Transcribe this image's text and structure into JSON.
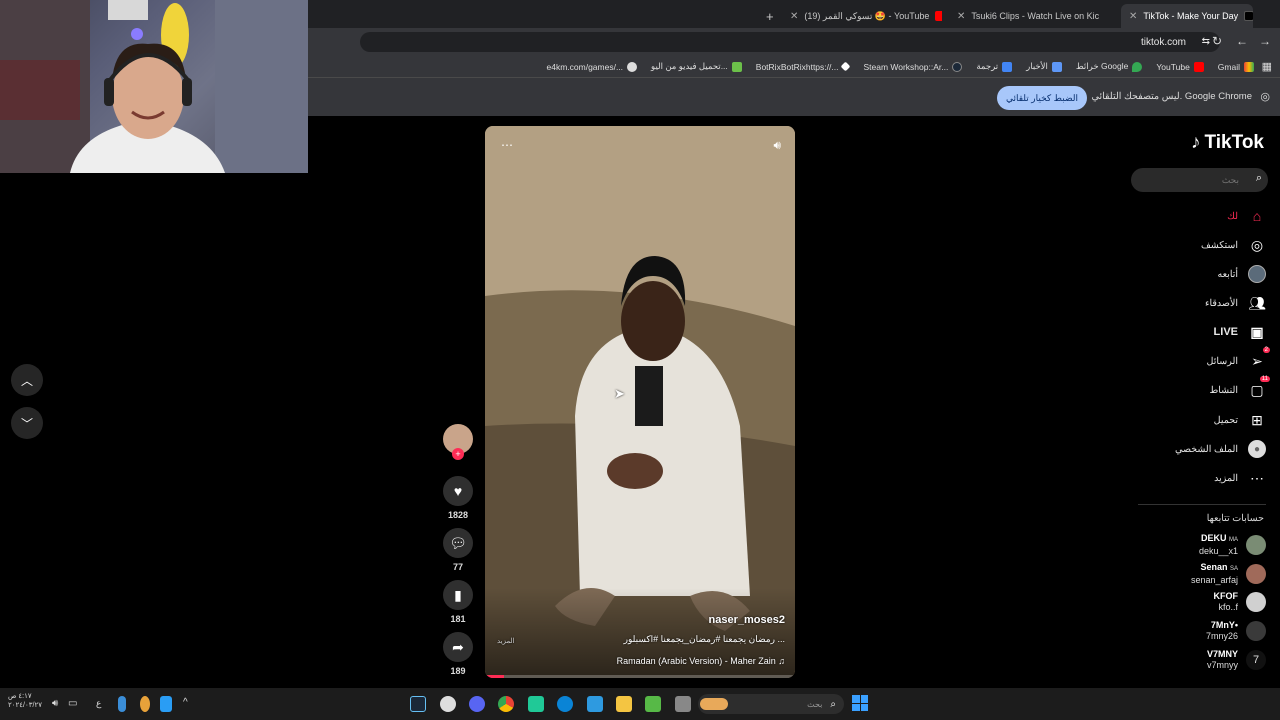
{
  "browser": {
    "tabs": [
      {
        "label": "TikTok - Make Your Day",
        "active": true
      },
      {
        "label": "Tsuki6 Clips - Watch Live on Kic",
        "active": false
      },
      {
        "label": "(19) تسوكي القمر 🤩 - YouTube",
        "active": false
      }
    ],
    "new_tab_icon": "plus-icon",
    "url": "tiktok.com",
    "bookmarks": [
      "Gmail",
      "YouTube",
      "خرائط Google",
      "الأخبار",
      "ترجمة",
      "Steam Workshop::Ar...",
      "BotRixBotRixhttps://...",
      "تحميل فيديو من اليو...",
      "e4km.com/games/..."
    ],
    "infobar": {
      "message": "ليس متصفحك التلقائي. Google Chrome",
      "button": "الضبط كخيار تلقائي"
    }
  },
  "video": {
    "username": "naser_moses2",
    "caption": "رمضان يجمعنا #رمضان_يجمعنا #اكسبلور ...",
    "more_label": "المزيد",
    "music": "Ramadan (Arabic Version) - Maher Zain",
    "progress_fraction": 0.06
  },
  "actions": {
    "likes": "1828",
    "comments": "77",
    "saves": "181",
    "shares": "189"
  },
  "tiktok": {
    "logo": "TikTok",
    "search_placeholder": "بحث",
    "nav": [
      {
        "label": "لك",
        "icon": "home-icon"
      },
      {
        "label": "استكشف",
        "icon": "compass-icon"
      },
      {
        "label": "أتابعه",
        "icon": "following-avatar-icon"
      },
      {
        "label": "الأصدقاء",
        "icon": "friends-icon"
      },
      {
        "label": "LIVE",
        "icon": "live-icon"
      },
      {
        "label": "الرسائل",
        "icon": "messages-icon",
        "badge": "2"
      },
      {
        "label": "النشاط",
        "icon": "activity-icon",
        "badge": "11"
      },
      {
        "label": "تحميل",
        "icon": "upload-icon"
      },
      {
        "label": "الملف الشخصي",
        "icon": "profile-icon"
      },
      {
        "label": "المزيد",
        "icon": "more-icon"
      }
    ],
    "following_header": "حسابات تتابعها",
    "following": [
      {
        "name": "DEKU",
        "tag": "MA",
        "handle": "deku__x1"
      },
      {
        "name": "Senan",
        "tag": "SA",
        "handle": "senan_arfaj"
      },
      {
        "name": "KFOF",
        "tag": "",
        "handle": "kfo..f"
      },
      {
        "name": "7MnY•",
        "tag": "",
        "handle": "7mny26"
      },
      {
        "name": "V7MNY",
        "tag": "",
        "handle": "v7mnyy"
      }
    ]
  },
  "taskbar": {
    "search_placeholder": "بحث",
    "time": "٤:١٧ ص",
    "date": "٢٠٢٤/٠٣/٢٧",
    "lang": "ع"
  },
  "colors": {
    "accent": "#fe2c55",
    "chrome_bg": "#35363a",
    "infobar_button": "#a8c7fa"
  }
}
